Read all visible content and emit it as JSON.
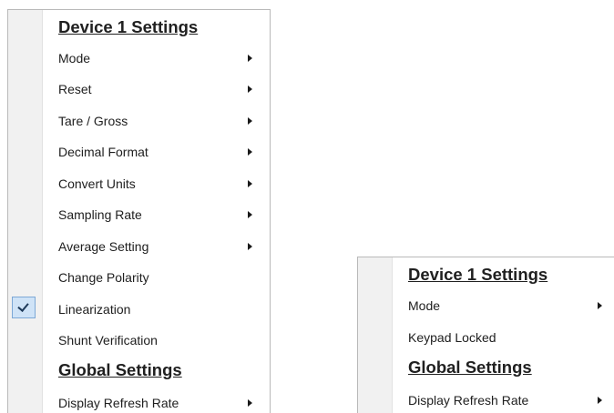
{
  "menu_main": {
    "device_header": "Device 1 Settings",
    "items": [
      {
        "label": "Mode",
        "has_submenu": true
      },
      {
        "label": "Reset",
        "has_submenu": true
      },
      {
        "label": "Tare / Gross",
        "has_submenu": true
      },
      {
        "label": "Decimal Format",
        "has_submenu": true
      },
      {
        "label": "Convert Units",
        "has_submenu": true
      },
      {
        "label": "Sampling Rate",
        "has_submenu": true
      },
      {
        "label": "Average Setting",
        "has_submenu": true
      },
      {
        "label": "Change Polarity",
        "has_submenu": false
      },
      {
        "label": "Linearization",
        "has_submenu": false,
        "checked": true
      },
      {
        "label": "Shunt Verification",
        "has_submenu": false
      }
    ],
    "global_header": "Global Settings",
    "global_items": [
      {
        "label": "Display Refresh Rate",
        "has_submenu": true
      }
    ]
  },
  "menu_secondary": {
    "device_header": "Device 1 Settings",
    "items": [
      {
        "label": "Mode",
        "has_submenu": true
      },
      {
        "label": "Keypad Locked",
        "has_submenu": false
      }
    ],
    "global_header": "Global Settings",
    "global_items": [
      {
        "label": "Display Refresh Rate",
        "has_submenu": true
      }
    ]
  },
  "icons": {
    "submenu": "chevron-right-icon",
    "check": "checkmark-icon"
  },
  "colors": {
    "text": "#202020",
    "gutter": "#f1f1f1",
    "check_highlight": "#cfe3f7",
    "check_border": "#7da8d6",
    "menu_border": "#b9b9b9"
  }
}
